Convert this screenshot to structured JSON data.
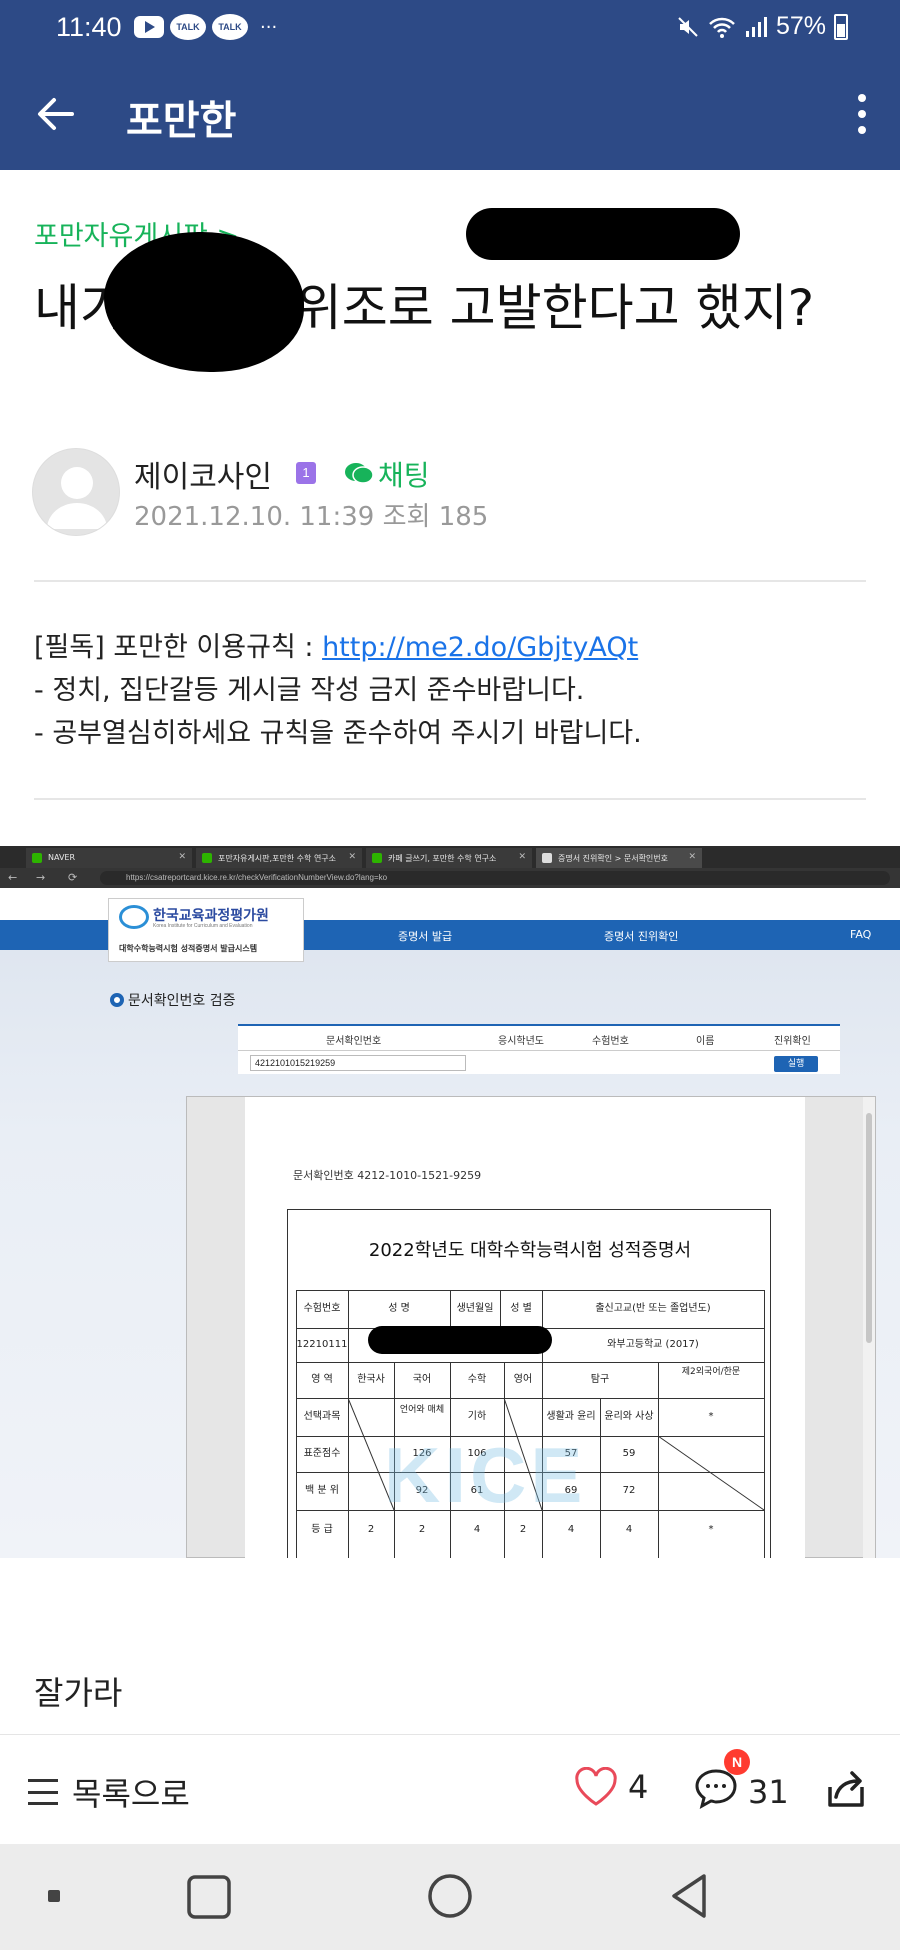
{
  "status_bar": {
    "time": "11:40",
    "talk_label": "TALK",
    "more": "···",
    "battery": "57%"
  },
  "app_bar": {
    "title": "포만한"
  },
  "post": {
    "board": "포만자유게시판 >",
    "title": "내가 공문서 위조로 고발한다고 했지?",
    "author": "제이코사인",
    "level": "1",
    "chat_label": "채팅",
    "date": "2021.12.10. 11:39",
    "views_label": "조회",
    "views": "185"
  },
  "notice": {
    "prefix": "[필독] 포만한 이용규칙 : ",
    "link": "http://me2.do/GbjtyAQt",
    "line2": "- 정치, 집단갈등 게시글 작성 금지 준수바랍니다.",
    "line3": "- 공부열심히하세요 규칙을 준수하여 주시기 바랍니다."
  },
  "embedded": {
    "tabs": [
      "NAVER",
      "포만자유게시판,포만한 수학 연구소",
      "카페 글쓰기, 포만한 수학 연구소",
      "증명서 진위확인 > 문서확인번호"
    ],
    "url": "https://csatreportcard.kice.re.kr/checkVerificationNumberView.do?lang=ko",
    "logo_title": "한국교육과정평가원",
    "logo_sub": "Korea Institute for Curriculum and Evaluation",
    "logo_desc": "대학수학능력시험 성적증명서 발급시스템",
    "nav": [
      "증명서 발급",
      "증명서 진위확인",
      "FAQ"
    ],
    "section_title": "문서확인번호 검증",
    "verify_headers": [
      "문서확인번호",
      "응시학년도",
      "수험번호",
      "이름",
      "진위확인"
    ],
    "verify_number": "4212101015219259",
    "verify_button": "실행",
    "doc_number": "문서확인번호  4212-1010-1521-9259",
    "cert_title": "2022학년도 대학수학능력시험 성적증명서",
    "info_headers": [
      "수험번호",
      "성  명",
      "생년월일",
      "성  별",
      "출신고교(반 또는 졸업년도)"
    ],
    "exam_no": "12210111",
    "school": "와부고등학교 (2017)",
    "row_labels": [
      "영    역",
      "선택과목",
      "표준점수",
      "백 분 위",
      "등    급"
    ],
    "subjects": [
      "한국사",
      "국어",
      "수학",
      "영어",
      "탐구",
      "제2외국어/한문"
    ],
    "electives": [
      "언어와 매체",
      "기하",
      "생활과 윤리",
      "윤리와 사상",
      "*"
    ],
    "standard_scores": [
      "126",
      "106",
      "57",
      "59"
    ],
    "percentiles": [
      "92",
      "61",
      "69",
      "72"
    ],
    "grades": [
      "2",
      "2",
      "4",
      "2",
      "4",
      "4",
      "*"
    ],
    "watermark": "KICE"
  },
  "after_text": "잘가라",
  "bottom_bar": {
    "list_label": "목록으로",
    "likes": "4",
    "comments": "31",
    "new_badge": "N"
  },
  "colors": {
    "header": "#2d4a86",
    "accent_green": "#17b35a",
    "link_blue": "#1a73e8",
    "kice_blue": "#1e64b4"
  }
}
